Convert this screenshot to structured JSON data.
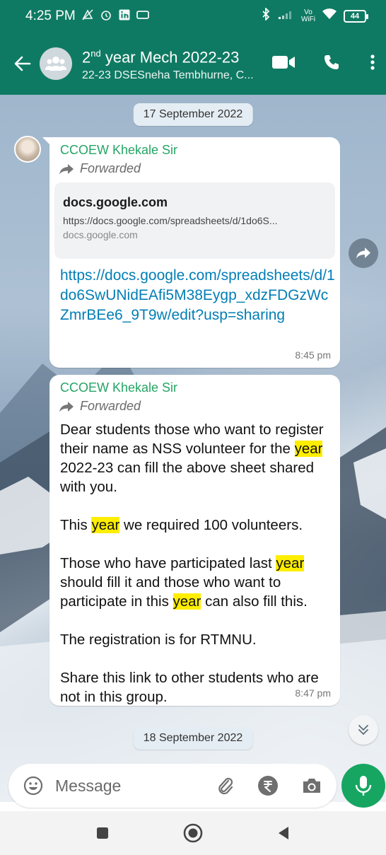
{
  "status_bar": {
    "time": "4:25 PM",
    "wifi_label": "Vo\nWiFi",
    "battery": "44"
  },
  "header": {
    "title_main": "2",
    "title_sup": "nd",
    "title_rest": " year Mech 2022-23",
    "subtitle": "22-23 DSESneha Tembhurne, C..."
  },
  "chat": {
    "dates": [
      "17 September 2022",
      "18 September 2022"
    ],
    "messages": [
      {
        "sender": "CCOEW Khekale Sir",
        "forwarded_label": "Forwarded",
        "preview": {
          "title": "docs.google.com",
          "url": "https://docs.google.com/spreadsheets/d/1do6S...",
          "domain": "docs.google.com"
        },
        "link": "https://docs.google.com/spreadsheets/d/1do6SwUNidEAfi5M38Eygp_xdzFDGzWcZmrBEe6_9T9w/edit?usp=sharing",
        "time": "8:45 pm"
      },
      {
        "sender": "CCOEW Khekale Sir",
        "forwarded_label": "Forwarded",
        "time": "8:47 pm",
        "highlight": "year",
        "p1_a": "Dear students those who want to register their name as NSS volunteer for the ",
        "p1_b": " 2022-23 can fill the above sheet shared with you.",
        "p2_a": "This ",
        "p2_b": " we required 100 volunteers.",
        "p3_a": "Those who have participated last ",
        "p3_b": " should fill it and those who want to participate in this ",
        "p3_c": " can also fill this.",
        "p4": "The registration is for RTMNU.",
        "p5": "Share this link to other students who are not in this group."
      }
    ]
  },
  "composer": {
    "placeholder": "Message"
  },
  "colors": {
    "header": "#0f7a63",
    "sender": "#25a566",
    "link": "#027eb5",
    "mic": "#16a662",
    "highlight": "#ffee00"
  }
}
